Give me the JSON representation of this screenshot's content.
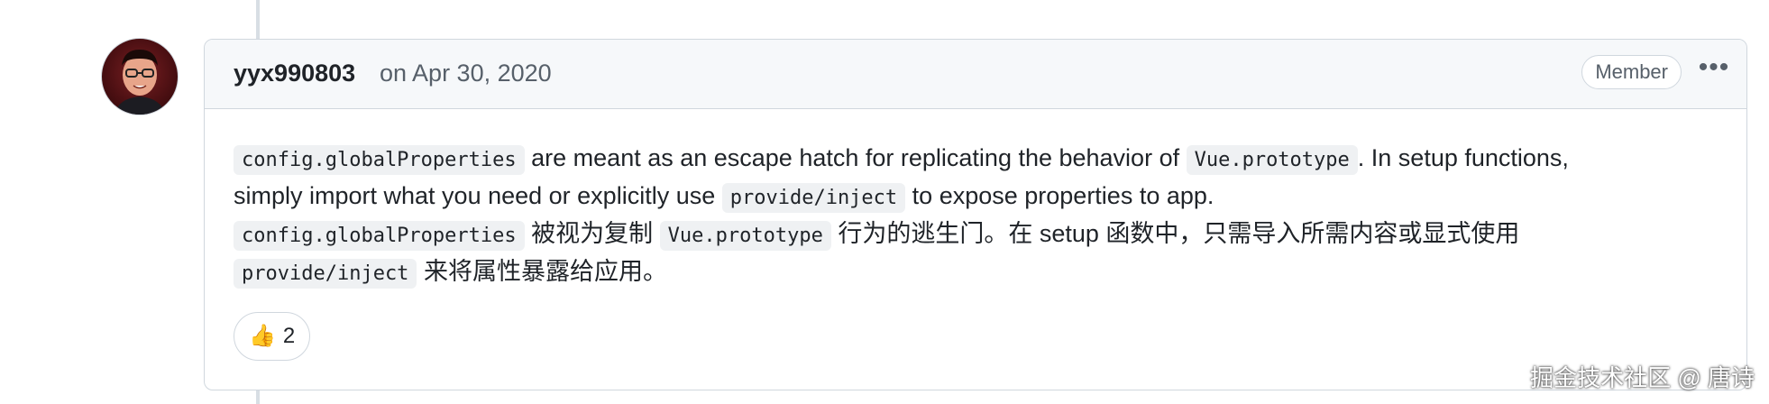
{
  "comment": {
    "author": "yyx990803",
    "date": "on Apr 30, 2020",
    "badge": "Member",
    "more_label": "•••",
    "body": {
      "line1": {
        "code1": "config.globalProperties",
        "text1": " are meant as an escape hatch for replicating the behavior of ",
        "code2": "Vue.prototype",
        "text2": ". In setup functions,"
      },
      "line2": {
        "text1": "simply import what you need or explicitly use ",
        "code1": "provide/inject",
        "text2": " to expose properties to app."
      },
      "line3": {
        "code1": "config.globalProperties",
        "text1": " 被视为复制 ",
        "code2": "Vue.prototype",
        "text2": " 行为的逃生门。在 setup 函数中，只需导入所需内容或显式使用"
      },
      "line4": {
        "code1": "provide/inject",
        "text1": " 来将属性暴露给应用。"
      }
    },
    "reaction": {
      "emoji": "👍",
      "icon": "thumbs-up-icon",
      "count": "2"
    }
  },
  "watermark": "掘金技术社区 @ 唐诗"
}
